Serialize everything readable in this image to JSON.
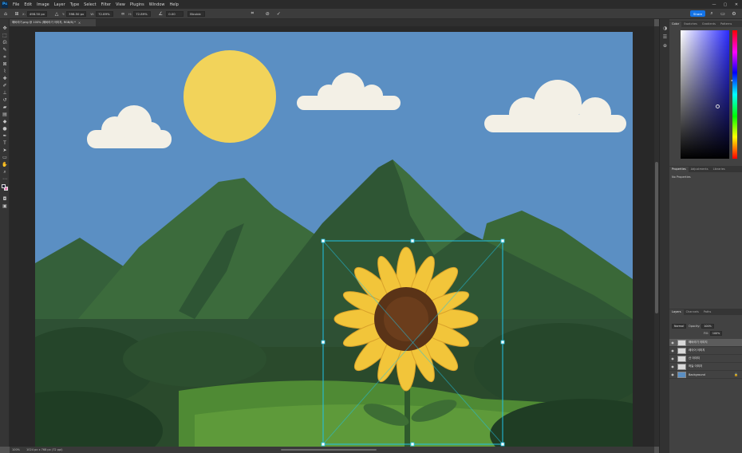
{
  "menubar": {
    "app_icon": "Ps",
    "items": [
      "File",
      "Edit",
      "Image",
      "Layer",
      "Type",
      "Select",
      "Filter",
      "View",
      "Plugins",
      "Window",
      "Help"
    ]
  },
  "window_controls": {
    "minimize": "—",
    "maximize": "▢",
    "close": "✕"
  },
  "options_bar": {
    "x_label": "X:",
    "x_value": "498.50 px",
    "y_label": "Y:",
    "y_value": "398.50 px",
    "w_label": "W:",
    "w_value": "72.89%",
    "h_label": "H:",
    "h_value": "72.89%",
    "angle_value": "0.00",
    "interp_value": "Bicubic",
    "share_label": "Share"
  },
  "document_tab": {
    "title": "해바라기.png @ 100% (해바라기 이미지, RGB/8) *",
    "close": "×"
  },
  "status_bar": {
    "zoom": "100%",
    "dimensions": "1024 px x 768 px (72 ppi)"
  },
  "panels": {
    "color_tabs": [
      "Color",
      "Swatches",
      "Gradients",
      "Patterns"
    ],
    "properties_tabs": [
      "Properties",
      "Adjustments",
      "Libraries"
    ],
    "properties_empty": "No Properties",
    "layers_tabs": [
      "Layers",
      "Channels",
      "Paths"
    ],
    "blend_mode": "Normal",
    "opacity_label": "Opacity:",
    "opacity_value": "100%",
    "fill_label": "Fill:",
    "fill_value": "100%",
    "layers": [
      {
        "name": "해바라기 이미지",
        "selected": true
      },
      {
        "name": "레이어 이미지",
        "selected": false
      },
      {
        "name": "산 이미지",
        "selected": false
      },
      {
        "name": "하늘 이미지",
        "selected": false
      },
      {
        "name": "Background",
        "selected": false
      }
    ]
  },
  "icons": {
    "toolbar": [
      "move-icon",
      "marquee-icon",
      "lasso-icon",
      "quick-select-icon",
      "crop-icon",
      "frame-icon",
      "eyedropper-icon",
      "healing-icon",
      "brush-icon",
      "stamp-icon",
      "history-brush-icon",
      "eraser-icon",
      "gradient-icon",
      "blur-icon",
      "dodge-icon",
      "pen-icon",
      "type-icon",
      "path-select-icon",
      "rectangle-icon",
      "hand-icon",
      "zoom-icon",
      "more-icon"
    ],
    "panel_column": [
      "color-panel-icon",
      "properties-panel-icon",
      "libraries-icon",
      "layers-panel-icon"
    ]
  },
  "colors": {
    "sky": "#5b8fc3",
    "sun": "#f2d35a",
    "cloud": "#f3f0e6",
    "mountain_light": "#3e6e3e",
    "mountain_dark": "#2d4f33",
    "foreground": "#22233a",
    "background_swatch": "#e97ab8",
    "accent": "#1473e6"
  }
}
